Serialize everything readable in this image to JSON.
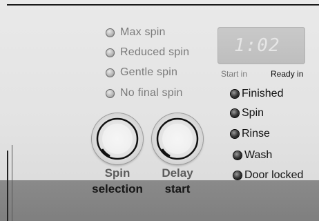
{
  "spin_options": [
    {
      "label": "Max spin"
    },
    {
      "label": "Reduced spin"
    },
    {
      "label": "Gentle spin"
    },
    {
      "label": "No final spin"
    }
  ],
  "display": {
    "time": "1:02",
    "start_in_label": "Start in",
    "ready_in_label": "Ready in"
  },
  "status_indicators": [
    {
      "label": "Finished"
    },
    {
      "label": "Spin"
    },
    {
      "label": "Rinse"
    },
    {
      "label": "Wash"
    },
    {
      "label": "Door locked"
    }
  ],
  "knobs": {
    "spin": {
      "line1": "Spin",
      "line2": "selection"
    },
    "delay": {
      "line1": "Delay",
      "line2": "start"
    }
  },
  "colors": {
    "panel": "#e3e3e3",
    "bottom_band": "#858585",
    "display_bg": "#c4c4c4",
    "indicator_led": "#111111"
  }
}
